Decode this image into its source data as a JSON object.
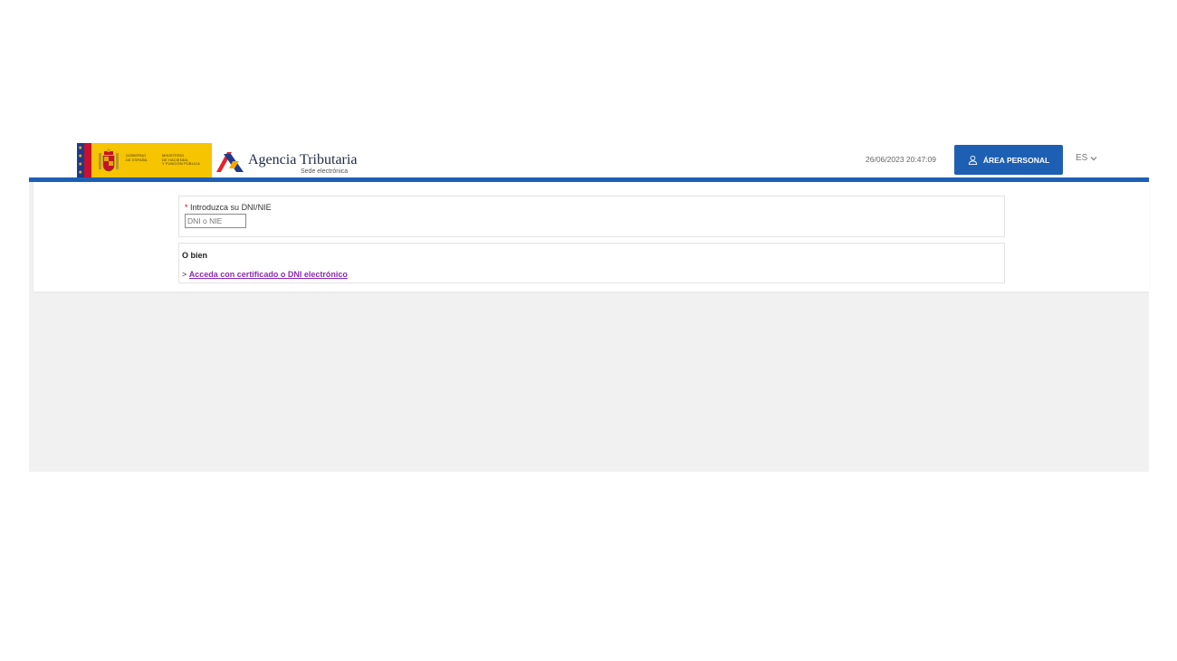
{
  "header": {
    "gov_logo": {
      "gobierno_lines": [
        "GOBIERNO",
        "DE ESPAÑA"
      ],
      "ministerio_lines": [
        "MINISTERIO",
        "DE HACIENDA",
        "Y FUNCIÓN PÚBLICA"
      ]
    },
    "agency_title": "Agencia Tributaria",
    "agency_subtitle": "Sede electrónica",
    "datetime": "26/06/2023 20:47:09",
    "area_personal_label": "ÁREA PERSONAL",
    "language": "ES"
  },
  "form": {
    "required_mark": "*",
    "dni_label": "Introduzca su DNI/NIE",
    "dni_placeholder": "DNI o NIE",
    "dni_value": ""
  },
  "alternative": {
    "heading": "O bien",
    "prefix": ">",
    "link_label": "Acceda con certificado o DNI electrónico"
  },
  "colors": {
    "accent_blue": "#1d5fb3",
    "gov_yellow": "#f6c400",
    "link_purple": "#8c2bb6",
    "required_red": "#d0021b"
  },
  "icons": {
    "user": "user-icon",
    "chevron": "chevron-down-icon"
  }
}
